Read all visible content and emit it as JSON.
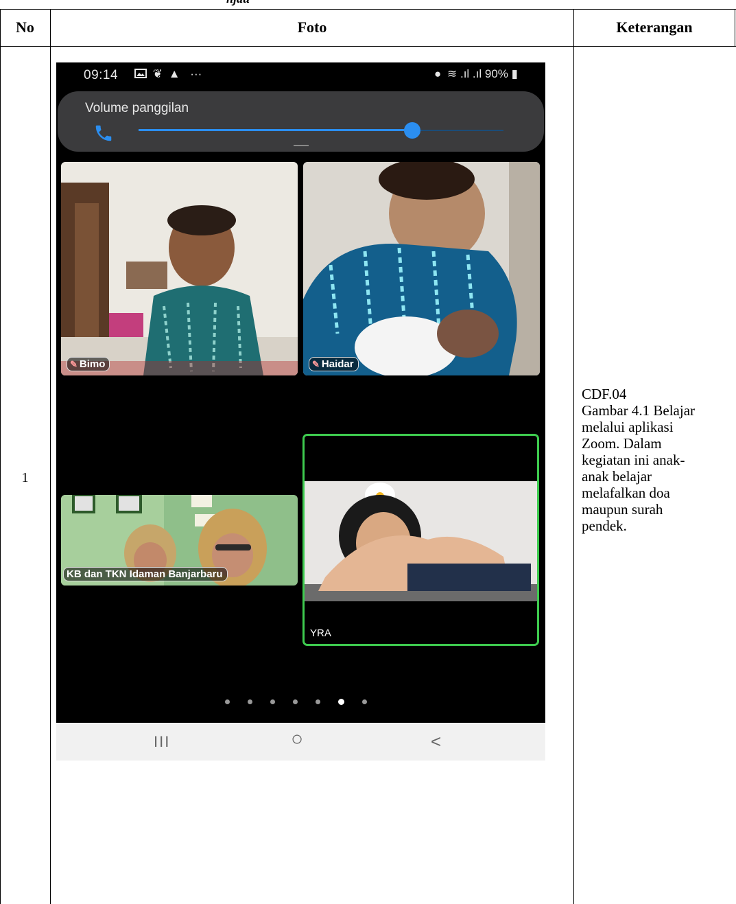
{
  "partial_caption": "njau",
  "table": {
    "headers": {
      "no": "No",
      "foto": "Foto",
      "keterangan": "Keterangan"
    },
    "rows": [
      {
        "no": "1",
        "keterangan_lines": [
          "CDF.04",
          "Gambar 4.1 Belajar",
          "melalui aplikasi",
          "Zoom. Dalam",
          "kegiatan ini anak-",
          "anak belajar",
          "melafalkan doa",
          "maupun surah",
          "pendek."
        ]
      }
    ]
  },
  "phone": {
    "status_bar": {
      "time": "09:14",
      "battery": "90%"
    },
    "volume_panel": {
      "title": "Volume panggilan",
      "level_fraction": 0.75
    },
    "participants": [
      {
        "name": "Bimo",
        "muted": true
      },
      {
        "name": "Haidar",
        "muted": true
      },
      {
        "name": "KB dan TKN Idaman Banjarbaru",
        "muted": false
      },
      {
        "name": "YRA",
        "muted": false,
        "active_speaker": true
      }
    ],
    "page_indicator": {
      "count": 7,
      "active_index": 5
    },
    "nav_bar": {
      "recent": "III",
      "home": "○",
      "back": "<"
    }
  },
  "colors": {
    "accent_blue": "#2b8ef0",
    "active_speaker_border": "#3ecb4f"
  }
}
